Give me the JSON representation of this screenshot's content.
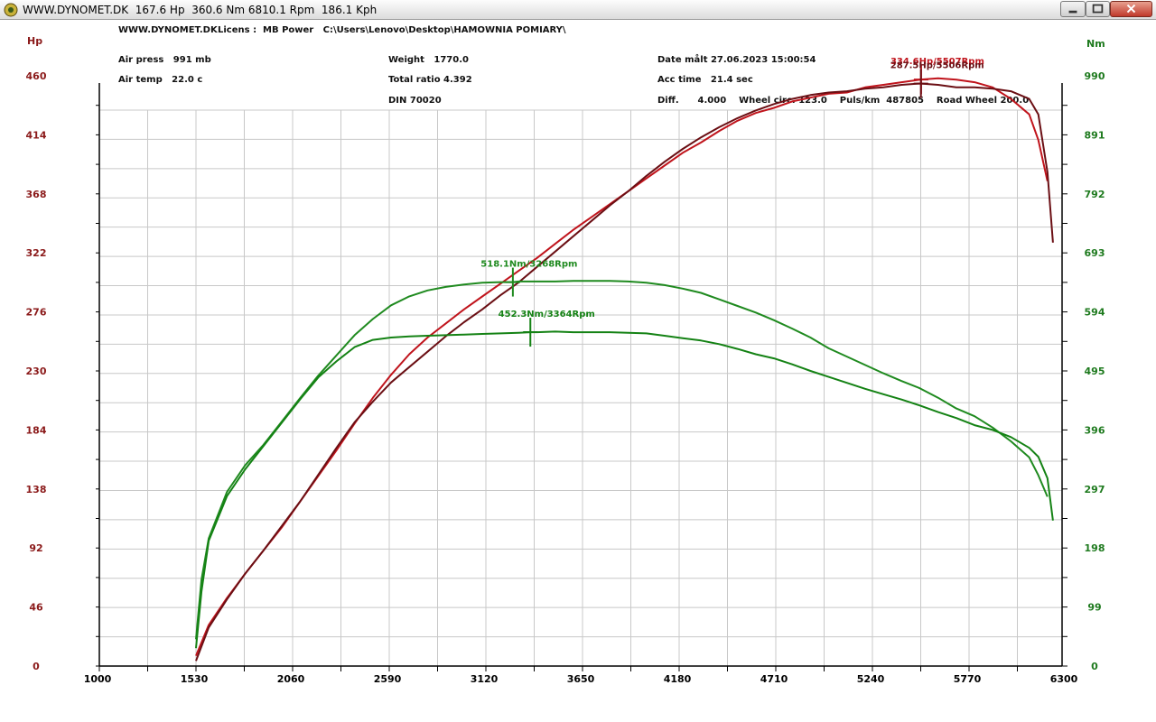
{
  "window": {
    "title": "WWW.DYNOMET.DK  167.6 Hp  360.6 Nm 6810.1 Rpm  186.1 Kph"
  },
  "header": {
    "site": "WWW.DYNOMET.DK",
    "licens": "Licens :  MB Power   C:\\Users\\Lenovo\\Desktop\\HAMOWNIA POMIARY\\",
    "air_press": "Air press   991 mb",
    "air_temp": "Air temp   22.0 c",
    "weight": "Weight   1770.0",
    "total_ratio": "Total ratio 4.392",
    "din": "DIN 70020",
    "date": "Date målt 27.06.2023 15:00:54",
    "acc_time": "Acc time   21.4 sec",
    "diff": "Diff.      4.000    Wheel circ. 123.0    Puls/km  487805    Road Wheel 200.0"
  },
  "colors": {
    "hp_axis": "#8b1a1a",
    "nm_axis": "#1e7a1e",
    "hp_run1": "#c0141c",
    "hp_run2": "#6b0f14",
    "nm_run1": "#1f8a1f",
    "nm_run2": "#148214",
    "grid": "#c8c8c8"
  },
  "chart_data": {
    "type": "line",
    "xlabel": "",
    "x_ticks": [
      "1000",
      "1530",
      "2060",
      "2590",
      "3120",
      "3650",
      "4180",
      "4710",
      "5240",
      "5770",
      "6300"
    ],
    "xlim": [
      1000,
      6340
    ],
    "left_axis": {
      "label": "Hp",
      "ticks": [
        "0",
        "46",
        "92",
        "138",
        "184",
        "230",
        "276",
        "322",
        "368",
        "414",
        "460"
      ],
      "range": [
        0,
        460
      ]
    },
    "right_axis": {
      "label": "Nm",
      "ticks": [
        "0",
        "99",
        "198",
        "297",
        "396",
        "495",
        "594",
        "693",
        "792",
        "891",
        "990"
      ],
      "range": [
        0,
        990
      ]
    },
    "grid": true,
    "series": [
      {
        "axis": "hp",
        "color_key": "hp_run1",
        "x": [
          1530,
          1600,
          1700,
          1800,
          1900,
          2000,
          2100,
          2200,
          2300,
          2400,
          2500,
          2600,
          2700,
          2800,
          2900,
          3000,
          3100,
          3200,
          3300,
          3400,
          3500,
          3600,
          3700,
          3800,
          3900,
          4000,
          4100,
          4200,
          4300,
          4400,
          4500,
          4600,
          4700,
          4800,
          4900,
          5000,
          5100,
          5200,
          5300,
          5400,
          5500,
          5600,
          5700,
          5800,
          5900,
          6000,
          6100,
          6150,
          6200
        ],
        "y": [
          8,
          32,
          53,
          72,
          90,
          108,
          128,
          148,
          168,
          189,
          209,
          227,
          243,
          256,
          267,
          278,
          288,
          298,
          308,
          318,
          329,
          340,
          350,
          360,
          370,
          380,
          390,
          400,
          408,
          417,
          425,
          431,
          435,
          440,
          443,
          446,
          447,
          451,
          453,
          455,
          457,
          458,
          457,
          455,
          451,
          442,
          430,
          410,
          378
        ]
      },
      {
        "axis": "hp",
        "color_key": "hp_run2",
        "x": [
          1530,
          1600,
          1700,
          1800,
          1900,
          2000,
          2100,
          2200,
          2300,
          2400,
          2500,
          2600,
          2700,
          2800,
          2900,
          3000,
          3100,
          3200,
          3300,
          3400,
          3500,
          3600,
          3700,
          3800,
          3900,
          4000,
          4100,
          4200,
          4300,
          4400,
          4500,
          4600,
          4700,
          4800,
          4900,
          5000,
          5100,
          5200,
          5300,
          5400,
          5500,
          5600,
          5700,
          5800,
          5900,
          6000,
          6100,
          6150,
          6200,
          6230
        ],
        "y": [
          4,
          30,
          52,
          72,
          90,
          109,
          128,
          149,
          170,
          190,
          206,
          221,
          233,
          245,
          257,
          268,
          278,
          289,
          299,
          311,
          323,
          335,
          347,
          359,
          370,
          382,
          393,
          403,
          412,
          420,
          427,
          433,
          438,
          442,
          445,
          447,
          448,
          450,
          451,
          453,
          454,
          453,
          451,
          451,
          450,
          448,
          442,
          430,
          385,
          330
        ]
      },
      {
        "axis": "nm",
        "color_key": "nm_run1",
        "x": [
          1530,
          1560,
          1600,
          1700,
          1800,
          1900,
          2000,
          2100,
          2200,
          2300,
          2400,
          2500,
          2600,
          2700,
          2800,
          2900,
          3000,
          3100,
          3200,
          3268,
          3300,
          3400,
          3500,
          3600,
          3700,
          3800,
          3900,
          4000,
          4100,
          4200,
          4300,
          4400,
          4500,
          4600,
          4700,
          4800,
          4900,
          5000,
          5100,
          5200,
          5300,
          5400,
          5500,
          5600,
          5700,
          5800,
          5900,
          6000,
          6100,
          6150,
          6200
        ],
        "y": [
          45,
          145,
          214,
          292,
          337,
          371,
          410,
          449,
          487,
          521,
          555,
          582,
          605,
          620,
          630,
          636,
          640,
          643,
          644,
          644,
          645,
          645,
          645,
          646,
          646,
          646,
          645,
          643,
          639,
          633,
          626,
          615,
          604,
          593,
          580,
          566,
          551,
          533,
          519,
          505,
          491,
          478,
          466,
          450,
          432,
          419,
          400,
          377,
          350,
          320,
          284
        ]
      },
      {
        "axis": "nm",
        "color_key": "nm_run2",
        "x": [
          1530,
          1560,
          1600,
          1700,
          1800,
          1900,
          2000,
          2100,
          2200,
          2300,
          2400,
          2500,
          2600,
          2700,
          2800,
          2900,
          3000,
          3100,
          3200,
          3300,
          3364,
          3400,
          3500,
          3600,
          3700,
          3800,
          3900,
          4000,
          4100,
          4200,
          4300,
          4400,
          4500,
          4600,
          4700,
          4800,
          4900,
          5000,
          5100,
          5200,
          5300,
          5400,
          5500,
          5600,
          5700,
          5800,
          5900,
          6000,
          6100,
          6150,
          6200,
          6230
        ],
        "y": [
          30,
          125,
          210,
          285,
          330,
          369,
          408,
          447,
          484,
          511,
          535,
          547,
          551,
          553,
          554,
          555,
          556,
          557,
          558,
          559,
          560,
          560,
          561,
          560,
          560,
          560,
          559,
          558,
          554,
          550,
          546,
          540,
          532,
          523,
          516,
          506,
          495,
          485,
          475,
          465,
          456,
          447,
          437,
          426,
          416,
          404,
          396,
          384,
          366,
          351,
          315,
          244
        ]
      }
    ],
    "annotations": [
      {
        "text": "334.6Hp/5507Rpm",
        "x": 5507,
        "value": 334.6,
        "axis": "hp",
        "color_key": "hp_run1"
      },
      {
        "text": "287.5Hp/5506Rpm",
        "x": 5506,
        "value": 287.5,
        "axis": "hp",
        "color_key": "hp_run2"
      },
      {
        "text": "518.1Nm/3268Rpm",
        "x": 3268,
        "value": 518.1,
        "axis": "nm",
        "color_key": "nm_run1"
      },
      {
        "text": "452.3Nm/3364Rpm",
        "x": 3364,
        "value": 452.3,
        "axis": "nm",
        "color_key": "nm_run2"
      }
    ]
  }
}
